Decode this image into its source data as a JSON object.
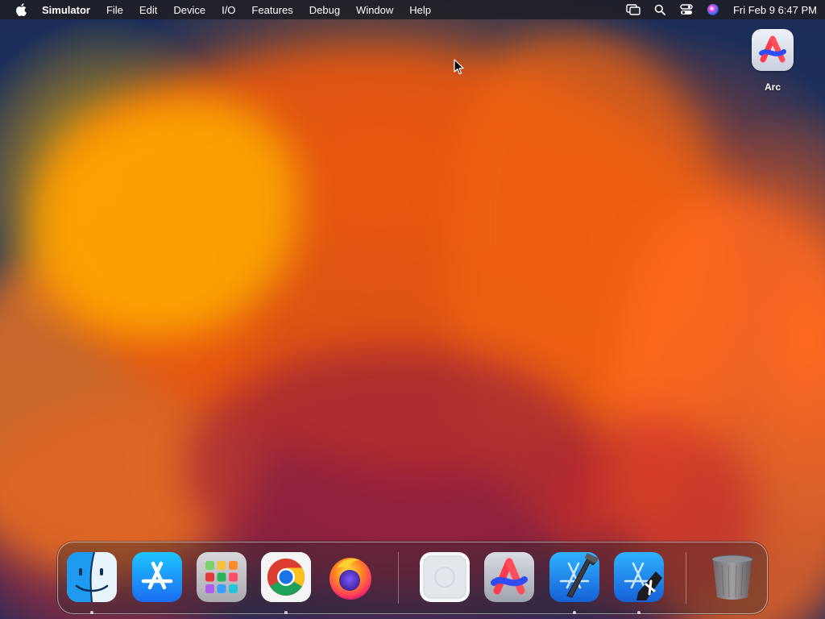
{
  "menubar": {
    "app_name": "Simulator",
    "items": [
      "File",
      "Edit",
      "Device",
      "I/O",
      "Features",
      "Debug",
      "Window",
      "Help"
    ],
    "clock": "Fri Feb 9  6:47 PM",
    "status_icons": [
      "screen-mirroring-icon",
      "spotlight-search-icon",
      "control-center-icon",
      "siri-icon"
    ]
  },
  "desktop": {
    "icons": [
      {
        "label": "Arc",
        "icon": "arc-icon"
      }
    ]
  },
  "dock": {
    "apps": [
      {
        "name": "Finder",
        "icon": "finder-icon",
        "running": true
      },
      {
        "name": "App Store",
        "icon": "app-store-icon",
        "running": false
      },
      {
        "name": "Launchpad",
        "icon": "launchpad-icon",
        "running": false
      },
      {
        "name": "Google Chrome",
        "icon": "chrome-icon",
        "running": true
      },
      {
        "name": "Firefox",
        "icon": "firefox-icon",
        "running": false
      },
      {
        "name": "Simulator",
        "icon": "simulator-icon",
        "running": false
      },
      {
        "name": "Arc",
        "icon": "arc-icon",
        "running": false
      },
      {
        "name": "Xcode",
        "icon": "xcode-icon",
        "running": true
      },
      {
        "name": "Xcode Beta",
        "icon": "xcode-beta-icon",
        "running": true
      },
      {
        "name": "Trash",
        "icon": "trash-icon",
        "running": false
      }
    ]
  },
  "colors": {
    "menubar_bg": "#1e1e24",
    "wallpaper_orange": "#e9560e",
    "wallpaper_yellow": "#ffad00",
    "wallpaper_navy": "#1a2e58"
  }
}
